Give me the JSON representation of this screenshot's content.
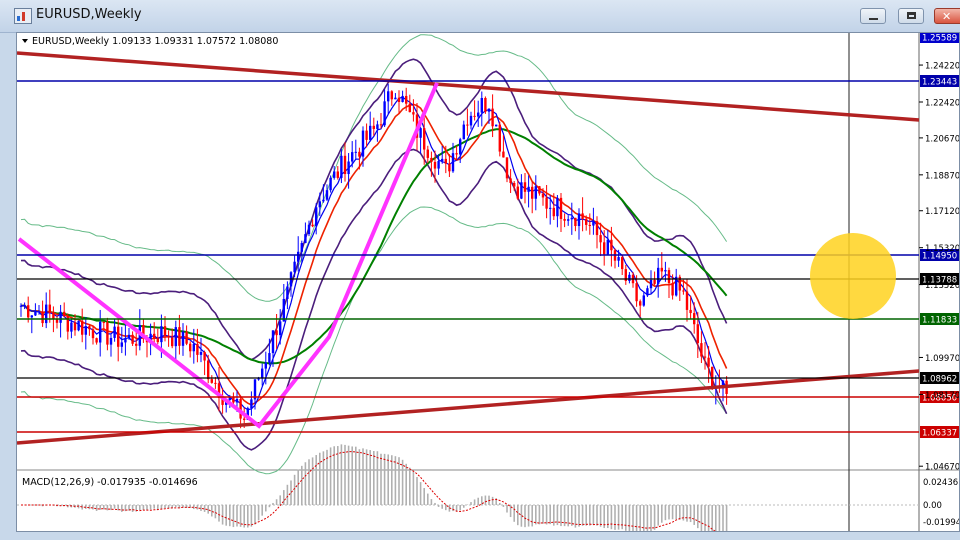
{
  "window": {
    "title": "EURUSD,Weekly",
    "min_symbol": "",
    "max_symbol": "",
    "close_symbol": "✕"
  },
  "chart": {
    "header": "EURUSD,Weekly  1.09133 1.09331 1.07572 1.08080",
    "macd_label": "MACD(12,26,9) -0.017935 -0.014696",
    "price_scale": [
      "1.24220",
      "1.22420",
      "1.20670",
      "1.18870",
      "1.17120",
      "1.15320",
      "1.13520",
      "1.09970",
      "1.08170",
      "1.04670"
    ],
    "macd_scale": [
      "0.02436",
      "0.00",
      "-0.01994"
    ],
    "level_labels": [
      {
        "value": "1.25589",
        "color": "#0000cc"
      },
      {
        "value": "1.23443",
        "color": "#0000aa"
      },
      {
        "value": "1.14950",
        "color": "#0000aa"
      },
      {
        "value": "1.13788",
        "color": "#000000"
      },
      {
        "value": "1.11833",
        "color": "#006400"
      },
      {
        "value": "1.08962",
        "color": "#000000"
      },
      {
        "value": "1.08050",
        "color": "#cc0000"
      },
      {
        "value": "1.06337",
        "color": "#cc0000"
      }
    ]
  },
  "colors": {
    "bull_candle": "#0000ff",
    "bear_candle": "#ff0000",
    "trendline": "#b22222",
    "magenta": "#ff33ff",
    "ema_red": "#ee2200",
    "ema_blue": "#0000ee",
    "envelope": "#4b1e7c",
    "sma_green": "#008000",
    "bollinger": "#66bb88",
    "highlight": "#ffd21e"
  },
  "icons": [
    "chart-app-icon",
    "minimize-icon",
    "maximize-icon",
    "close-icon",
    "dropdown-triangle-icon",
    "highlight-circle"
  ]
}
